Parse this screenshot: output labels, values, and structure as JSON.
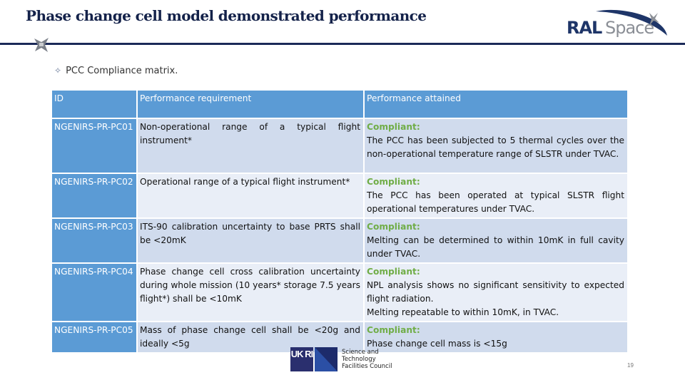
{
  "slide": {
    "title": "Phase change cell model demonstrated performance",
    "bullet_icon": "four-point-star-icon",
    "bullet_text": "PCC Compliance matrix.",
    "page_number": "19"
  },
  "logos": {
    "ral_text_1": "RAL",
    "ral_text_2": "Space",
    "ukri_text": "UK RI",
    "stfc_line1": "Science and",
    "stfc_line2": "Technology",
    "stfc_line3": "Facilities Council"
  },
  "table": {
    "headers": [
      "ID",
      "Performance requirement",
      "Performance attained"
    ],
    "rows": [
      {
        "id": "NGENIRS-PR-PC01",
        "requirement": "Non-operational range of a typical flight instrument*",
        "status": "Compliant:",
        "attained": "The PCC has been subjected to 5 thermal cycles over the non-operational temperature range of SLSTR under TVAC."
      },
      {
        "id": "NGENIRS-PR-PC02",
        "requirement": "Operational range of a typical flight instrument*",
        "status": "Compliant:",
        "attained": "The PCC has been operated at typical SLSTR flight operational temperatures under TVAC."
      },
      {
        "id": "NGENIRS-PR-PC03",
        "requirement": "ITS-90 calibration uncertainty to base PRTS shall be <20mK",
        "status": "Compliant:",
        "attained": "Melting can be determined to within 10mK in full cavity under TVAC."
      },
      {
        "id": "NGENIRS-PR-PC04",
        "requirement": "Phase change cell cross calibration uncertainty during whole mission (10 years* storage 7.5 years flight*) shall be <10mK",
        "status": "Compliant:",
        "attained": "NPL analysis shows no significant sensitivity to expected flight radiation.",
        "attained_extra": "Melting repeatable to within 10mK, in TVAC."
      },
      {
        "id": "NGENIRS-PR-PC05",
        "requirement": "Mass of phase change cell shall be <20g and ideally <5g",
        "status": "Compliant:",
        "attained": "Phase change cell mass is <15g"
      }
    ]
  },
  "colors": {
    "title": "#14224a",
    "rule": "#1b2a58",
    "header_blue": "#5b9bd5",
    "row_dark": "#d0dbed",
    "row_light": "#e9eef7",
    "compliant_green": "#70ad47"
  }
}
